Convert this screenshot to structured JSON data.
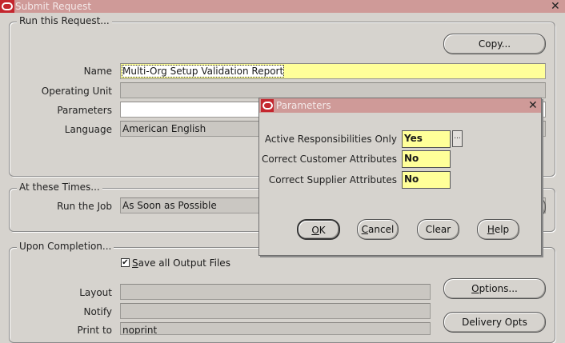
{
  "window": {
    "title": "Submit Request"
  },
  "run_request": {
    "group_title": "Run this Request...",
    "copy_label": "Copy...",
    "name_label": "Name",
    "name_value": "Multi-Org Setup Validation Report",
    "operating_unit_label": "Operating Unit",
    "operating_unit_value": "",
    "parameters_label": "Parameters",
    "parameters_value": "",
    "language_label": "Language",
    "language_value": "American English"
  },
  "at_times": {
    "group_title": "At these Times...",
    "run_job_label": "Run the Job",
    "run_job_value": "As Soon as Possible"
  },
  "upon_completion": {
    "group_title": "Upon Completion...",
    "save_files_label_first": "S",
    "save_files_label_rest": "ave all Output Files",
    "save_files_checked": true,
    "layout_label": "Layout",
    "notify_label": "Notify",
    "print_to_label": "Print to",
    "print_to_value": "noprint",
    "options_first": "O",
    "options_rest": "ptions...",
    "delivery_label": "Delivery Opts"
  },
  "dialog": {
    "title": "Parameters",
    "params": [
      {
        "label": "Active Responsibilities Only",
        "value": "Yes"
      },
      {
        "label": "Correct Customer Attributes",
        "value": "No"
      },
      {
        "label": "Correct Supplier Attributes",
        "value": "No"
      }
    ],
    "lov_label": "...",
    "ok_first": "O",
    "ok_rest": "K",
    "cancel_first": "C",
    "cancel_rest": "ancel",
    "clear_label": "Clear",
    "help_first": "H",
    "help_rest": "elp"
  },
  "colors": {
    "titlebar": "#cf9a98",
    "required_field": "#ffff99",
    "background": "#d6d3ce",
    "oracle_red": "#c4262e"
  },
  "icons": [
    "oracle-logo-icon",
    "close-icon",
    "checkmark-icon",
    "ellipsis-icon"
  ]
}
